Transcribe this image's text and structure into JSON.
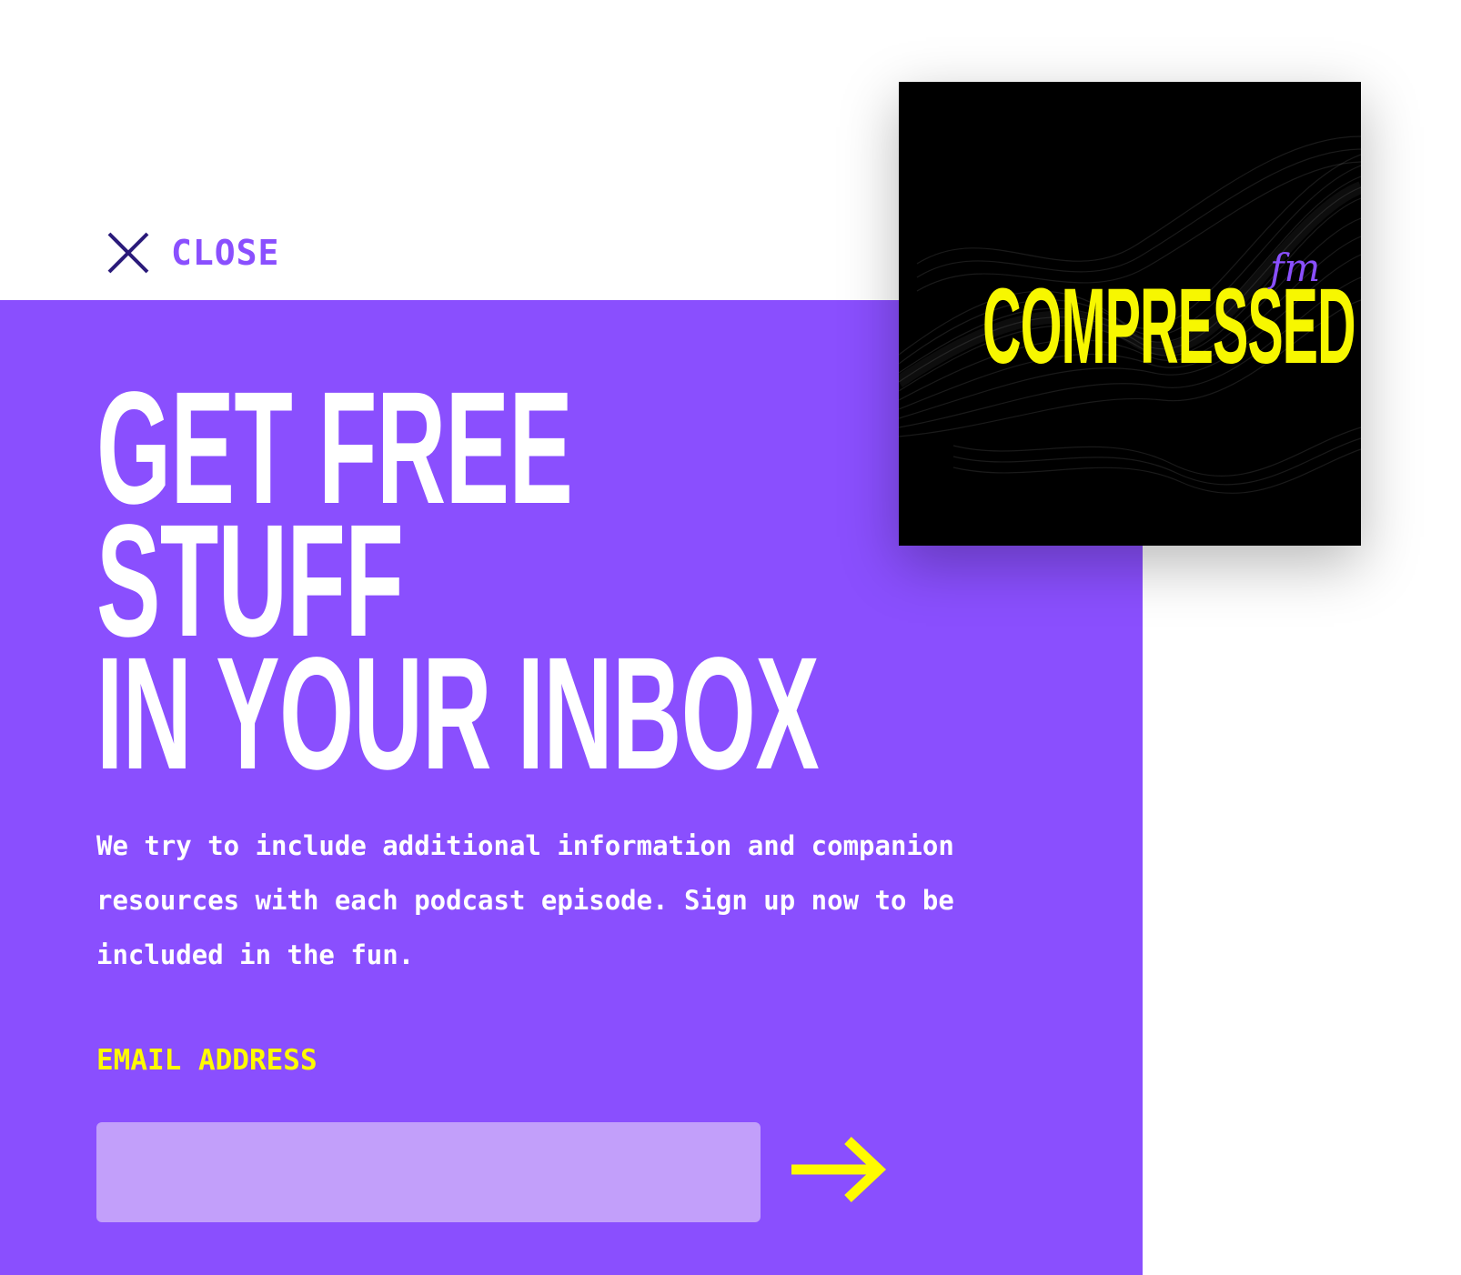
{
  "close": {
    "label": "CLOSE"
  },
  "hero": {
    "line1": "GET FREE",
    "line2": "STUFF",
    "line3": "IN YOUR INBOX"
  },
  "description": "We try to include additional information and companion resources with each podcast episode. Sign up now to be included in the fun.",
  "form": {
    "email_label": "EMAIL ADDRESS",
    "email_value": "",
    "email_placeholder": ""
  },
  "podcast_cover": {
    "title": "COMPRESSED",
    "suffix": "fm"
  },
  "colors": {
    "brand_purple": "#8a4ffe",
    "accent_yellow": "#fffb00",
    "input_bg": "#c29ffa",
    "close_x": "#2a1a7a"
  }
}
